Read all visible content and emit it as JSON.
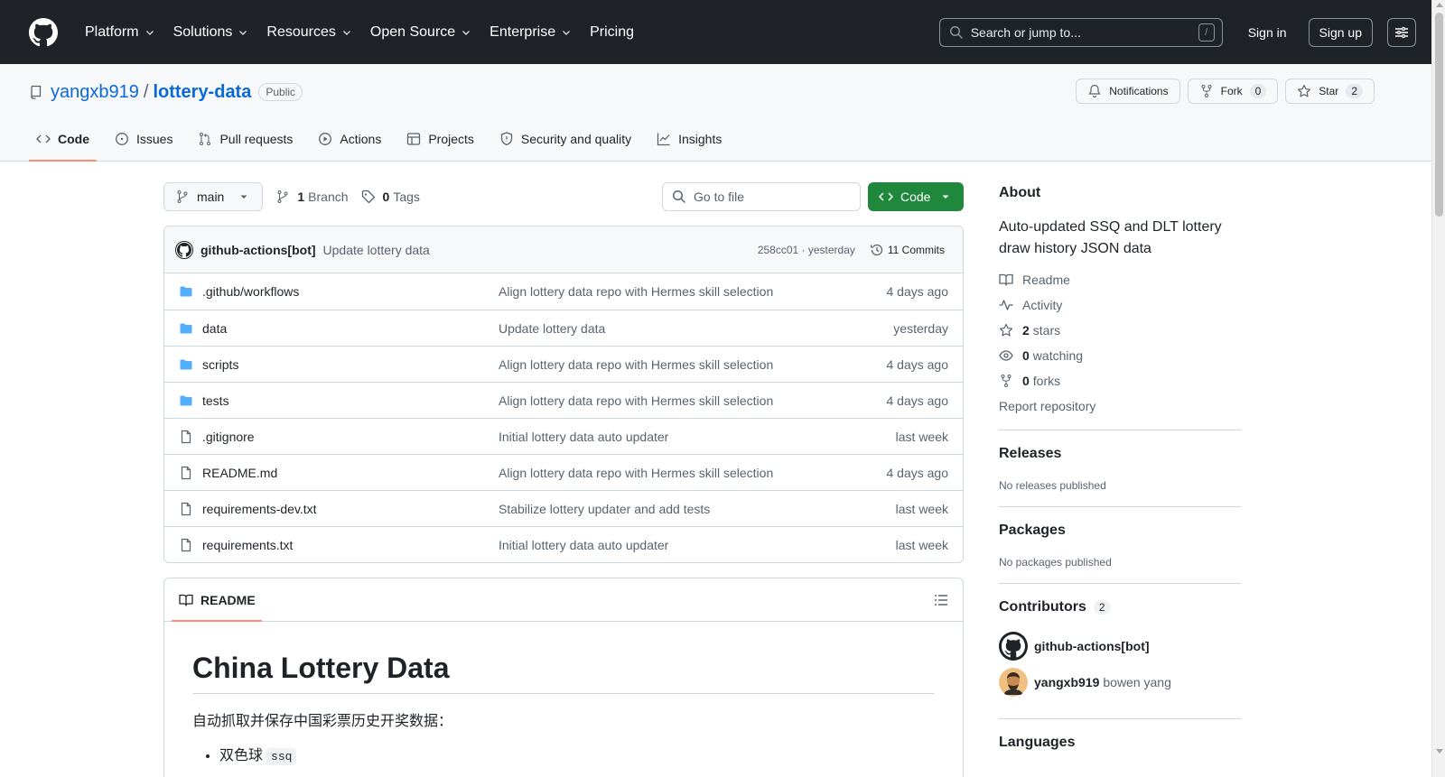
{
  "header": {
    "nav": [
      "Platform",
      "Solutions",
      "Resources",
      "Open Source",
      "Enterprise",
      "Pricing"
    ],
    "search_placeholder": "Search or jump to...",
    "search_key": "/",
    "signin": "Sign in",
    "signup": "Sign up"
  },
  "repo": {
    "owner": "yangxb919",
    "separator": "/",
    "name": "lottery-data",
    "visibility": "Public",
    "notifications": "Notifications",
    "fork": "Fork",
    "fork_count": "0",
    "star": "Star",
    "star_count": "2",
    "tabs": [
      "Code",
      "Issues",
      "Pull requests",
      "Actions",
      "Projects",
      "Security and quality",
      "Insights"
    ]
  },
  "file_nav": {
    "branch": "main",
    "branch_count": "1",
    "branch_label": "Branch",
    "tag_count": "0",
    "tag_label": "Tags",
    "goto_placeholder": "Go to file",
    "code_button": "Code"
  },
  "latest_commit": {
    "author": "github-actions[bot]",
    "message": "Update lottery data",
    "meta": "258cc01 · yesterday",
    "commits": "11 Commits"
  },
  "files": [
    {
      "name": ".github/workflows",
      "type": "dir",
      "commit": "Align lottery data repo with Hermes skill selection",
      "time": "4 days ago"
    },
    {
      "name": "data",
      "type": "dir",
      "commit": "Update lottery data",
      "time": "yesterday"
    },
    {
      "name": "scripts",
      "type": "dir",
      "commit": "Align lottery data repo with Hermes skill selection",
      "time": "4 days ago"
    },
    {
      "name": "tests",
      "type": "dir",
      "commit": "Align lottery data repo with Hermes skill selection",
      "time": "4 days ago"
    },
    {
      "name": ".gitignore",
      "type": "file",
      "commit": "Initial lottery data auto updater",
      "time": "last week"
    },
    {
      "name": "README.md",
      "type": "file",
      "commit": "Align lottery data repo with Hermes skill selection",
      "time": "4 days ago"
    },
    {
      "name": "requirements-dev.txt",
      "type": "file",
      "commit": "Stabilize lottery updater and add tests",
      "time": "last week"
    },
    {
      "name": "requirements.txt",
      "type": "file",
      "commit": "Initial lottery data auto updater",
      "time": "last week"
    }
  ],
  "readme": {
    "tab": "README",
    "title": "China Lottery Data",
    "intro": "自动抓取并保存中国彩票历史开奖数据：",
    "item1_text": "双色球",
    "item1_code": "ssq"
  },
  "sidebar": {
    "about_title": "About",
    "description": "Auto-updated SSQ and DLT lottery draw history JSON data",
    "readme": "Readme",
    "activity": "Activity",
    "stars_count": "2",
    "stars_label": "stars",
    "watching_count": "0",
    "watching_label": "watching",
    "forks_count": "0",
    "forks_label": "forks",
    "report": "Report repository",
    "releases_title": "Releases",
    "releases_empty": "No releases published",
    "packages_title": "Packages",
    "packages_empty": "No packages published",
    "contributors_title": "Contributors",
    "contributors_count": "2",
    "contributors": [
      {
        "login": "github-actions[bot]",
        "name": ""
      },
      {
        "login": "yangxb919",
        "name": "bowen yang"
      }
    ],
    "languages_title": "Languages"
  },
  "colors": {
    "header_bg": "#1f2328",
    "link": "#0969da",
    "code_button": "#1f883d",
    "tab_underline": "#fd8c73",
    "folder": "#54aeff"
  }
}
